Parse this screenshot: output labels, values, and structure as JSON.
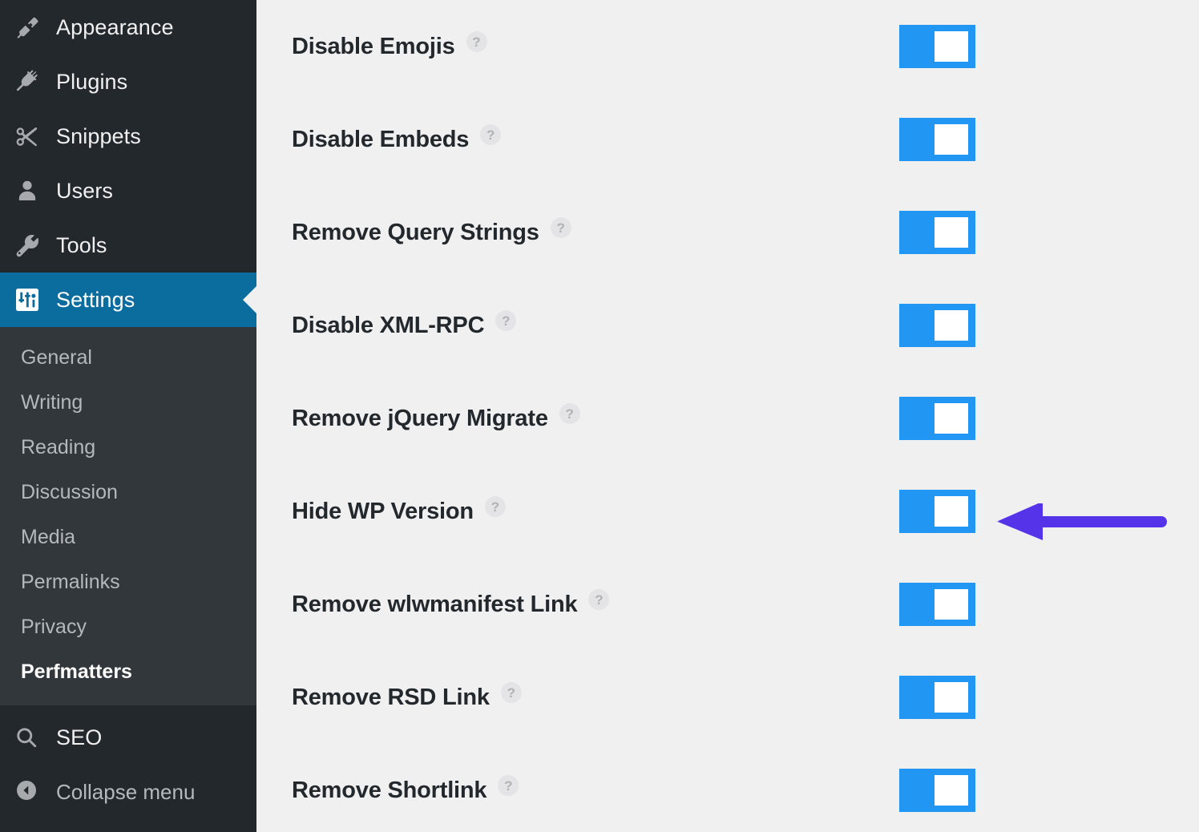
{
  "sidebar": {
    "menu": [
      {
        "label": "Appearance",
        "icon": "paintbrush-icon",
        "active": false
      },
      {
        "label": "Plugins",
        "icon": "plug-icon",
        "active": false
      },
      {
        "label": "Snippets",
        "icon": "scissors-icon",
        "active": false
      },
      {
        "label": "Users",
        "icon": "user-icon",
        "active": false
      },
      {
        "label": "Tools",
        "icon": "wrench-icon",
        "active": false
      },
      {
        "label": "Settings",
        "icon": "sliders-icon",
        "active": true
      }
    ],
    "submenu": [
      {
        "label": "General",
        "current": false
      },
      {
        "label": "Writing",
        "current": false
      },
      {
        "label": "Reading",
        "current": false
      },
      {
        "label": "Discussion",
        "current": false
      },
      {
        "label": "Media",
        "current": false
      },
      {
        "label": "Permalinks",
        "current": false
      },
      {
        "label": "Privacy",
        "current": false
      },
      {
        "label": "Perfmatters",
        "current": true
      }
    ],
    "bottom": [
      {
        "label": "SEO",
        "icon": "search-icon"
      }
    ],
    "collapse": {
      "label": "Collapse menu",
      "icon": "collapse-arrow-icon"
    },
    "colors": {
      "menu_bg": "#23282d",
      "submenu_bg": "#32373c",
      "active_bg": "#0b6c9e",
      "label": "#f0f0f1",
      "submenu_label": "#b4b9be"
    }
  },
  "main": {
    "help_glyph": "?",
    "toggle_color": "#2196f3",
    "background": "#f0f0f1",
    "settings": [
      {
        "label": "Disable Emojis",
        "enabled": true,
        "state": "on"
      },
      {
        "label": "Disable Embeds",
        "enabled": true,
        "state": "on"
      },
      {
        "label": "Remove Query Strings",
        "enabled": true,
        "state": "on"
      },
      {
        "label": "Disable XML-RPC",
        "enabled": true,
        "state": "on"
      },
      {
        "label": "Remove jQuery Migrate",
        "enabled": true,
        "state": "on"
      },
      {
        "label": "Hide WP Version",
        "enabled": true,
        "state": "on"
      },
      {
        "label": "Remove wlwmanifest Link",
        "enabled": true,
        "state": "on"
      },
      {
        "label": "Remove RSD Link",
        "enabled": true,
        "state": "on"
      },
      {
        "label": "Remove Shortlink",
        "enabled": true,
        "state": "on"
      }
    ]
  },
  "annotation": {
    "type": "arrow",
    "direction": "left",
    "color": "#5433e8",
    "points_at": "Hide WP Version"
  }
}
